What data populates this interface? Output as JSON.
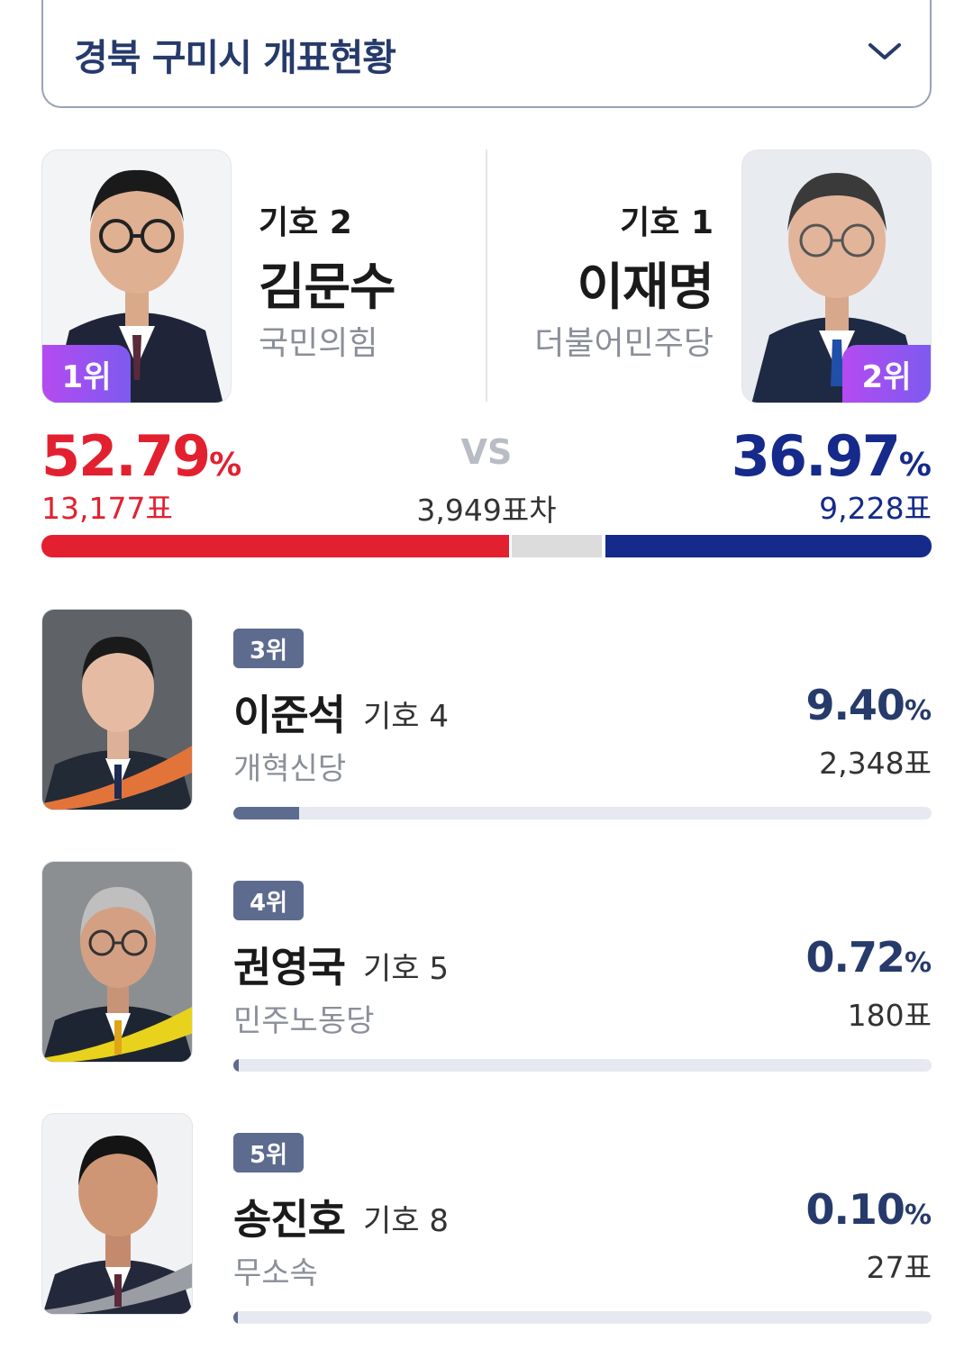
{
  "region": {
    "title": "경북 구미시 개표현황"
  },
  "top": {
    "left": {
      "rank": "1위",
      "number": "기호 2",
      "name": "김문수",
      "party": "국민의힘",
      "pct": "52.79",
      "unit": "%",
      "votes": "13,177표",
      "color": "#e2202f"
    },
    "right": {
      "rank": "2위",
      "number": "기호 1",
      "name": "이재명",
      "party": "더불어민주당",
      "pct": "36.97",
      "unit": "%",
      "votes": "9,228표",
      "color": "#152a8a"
    },
    "vs": "VS",
    "diff": "3,949표차"
  },
  "others": [
    {
      "rank": "3위",
      "name": "이준석",
      "number": "기호 4",
      "party": "개혁신당",
      "pct": "9.40",
      "unit": "%",
      "votes": "2,348표",
      "share": 0.094
    },
    {
      "rank": "4위",
      "name": "권영국",
      "number": "기호 5",
      "party": "민주노동당",
      "pct": "0.72",
      "unit": "%",
      "votes": "180표",
      "share": 0.0072
    },
    {
      "rank": "5위",
      "name": "송진호",
      "number": "기호 8",
      "party": "무소속",
      "pct": "0.10",
      "unit": "%",
      "votes": "27표",
      "share": 0.001
    }
  ]
}
